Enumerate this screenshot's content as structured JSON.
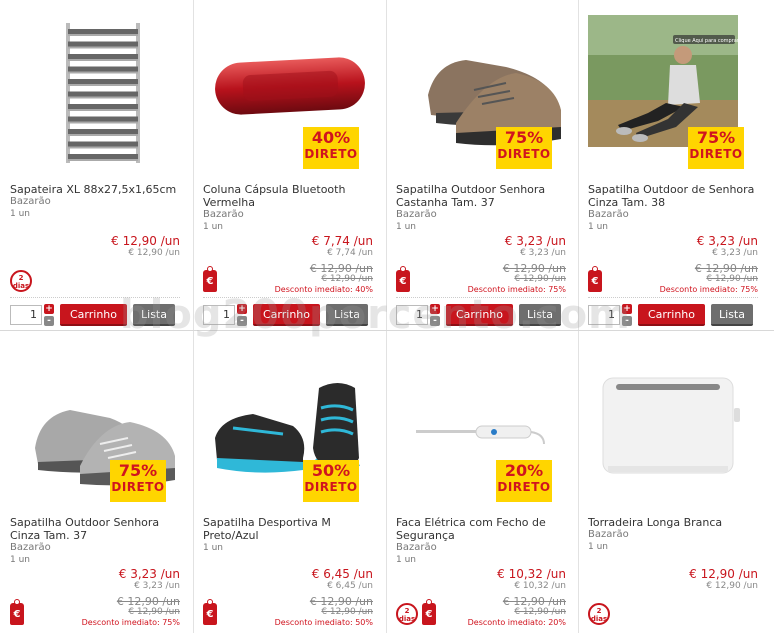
{
  "watermark": "blog200porcento.com",
  "products": [
    {
      "name": "Sapateira XL 88x27,5x1,65cm",
      "brand": "Bazarão",
      "unit": "1 un",
      "price": "€ 12,90 /un",
      "unit_price": "€ 12,90 /un",
      "badge_pct": "",
      "badge_text": "",
      "old_price": "",
      "old_unit": "",
      "discount": "",
      "icon_days": "2\ndias",
      "icon_euro": false,
      "image": "shoe-rack"
    },
    {
      "name": "Coluna Cápsula Bluetooth Vermelha",
      "brand": "Bazarão",
      "unit": "1 un",
      "price": "€ 7,74 /un",
      "unit_price": "€ 7,74 /un",
      "badge_pct": "40%",
      "badge_text": "DIRETO",
      "old_price": "€ 12,90 /un",
      "old_unit": "€ 12,90 /un",
      "discount": "Desconto imediato: 40%",
      "icon_days": "",
      "icon_euro": true,
      "image": "speaker"
    },
    {
      "name": "Sapatilha Outdoor Senhora Castanha Tam. 37",
      "brand": "Bazarão",
      "unit": "1 un",
      "price": "€ 3,23 /un",
      "unit_price": "€ 3,23 /un",
      "badge_pct": "75%",
      "badge_text": "DIRETO",
      "old_price": "€ 12,90 /un",
      "old_unit": "€ 12,90 /un",
      "discount": "Desconto imediato: 75%",
      "icon_days": "",
      "icon_euro": true,
      "image": "brown-shoe"
    },
    {
      "name": "Sapatilha Outdoor de Senhora Cinza Tam. 38",
      "brand": "Bazarão",
      "unit": "1 un",
      "price": "€ 3,23 /un",
      "unit_price": "€ 3,23 /un",
      "badge_pct": "75%",
      "badge_text": "DIRETO",
      "old_price": "€ 12,90 /un",
      "old_unit": "€ 12,90 /un",
      "discount": "Desconto imediato: 75%",
      "icon_days": "",
      "icon_euro": true,
      "image": "photo",
      "photo_text": "Clique Aqui para comprar"
    },
    {
      "name": "Sapatilha Outdoor Senhora Cinza Tam. 37",
      "brand": "Bazarão",
      "unit": "1 un",
      "price": "€ 3,23 /un",
      "unit_price": "€ 3,23 /un",
      "badge_pct": "75%",
      "badge_text": "DIRETO",
      "old_price": "€ 12,90 /un",
      "old_unit": "€ 12,90 /un",
      "discount": "Desconto imediato: 75%",
      "icon_days": "",
      "icon_euro": true,
      "image": "grey-shoe"
    },
    {
      "name": "Sapatilha Desportiva M Preto/Azul",
      "brand": "",
      "unit": "1 un",
      "price": "€ 6,45 /un",
      "unit_price": "€ 6,45 /un",
      "badge_pct": "50%",
      "badge_text": "DIRETO",
      "old_price": "€ 12,90 /un",
      "old_unit": "€ 12,90 /un",
      "discount": "Desconto imediato: 50%",
      "icon_days": "",
      "icon_euro": true,
      "image": "sport-shoe"
    },
    {
      "name": "Faca Elétrica com Fecho de Segurança",
      "brand": "Bazarão",
      "unit": "1 un",
      "price": "€ 10,32 /un",
      "unit_price": "€ 10,32 /un",
      "badge_pct": "20%",
      "badge_text": "DIRETO",
      "old_price": "€ 12,90 /un",
      "old_unit": "€ 12,90 /un",
      "discount": "Desconto imediato: 20%",
      "icon_days": "2\ndias",
      "icon_euro": true,
      "image": "knife"
    },
    {
      "name": "Torradeira Longa Branca",
      "brand": "Bazarão",
      "unit": "1 un",
      "price": "€ 12,90 /un",
      "unit_price": "€ 12,90 /un",
      "badge_pct": "",
      "badge_text": "",
      "old_price": "",
      "old_unit": "",
      "discount": "",
      "icon_days": "2\ndias",
      "icon_euro": false,
      "image": "toaster"
    }
  ],
  "controls": {
    "qty": "1",
    "plus": "+",
    "minus": "-",
    "cart_label": "Carrinho",
    "list_label": "Lista"
  }
}
